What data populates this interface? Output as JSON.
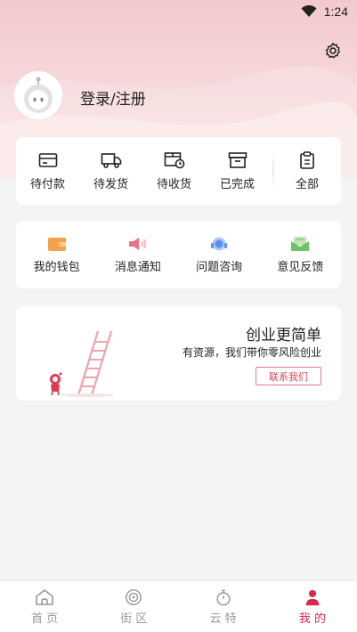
{
  "status_bar": {
    "time": "1:24",
    "icons": [
      "wifi-icon",
      "battery-icon"
    ]
  },
  "profile": {
    "login_label": "登录/注册",
    "settings_icon": "gear-icon"
  },
  "orders": [
    {
      "label": "待付款",
      "icon": "card-icon"
    },
    {
      "label": "待发货",
      "icon": "truck-icon"
    },
    {
      "label": "待收货",
      "icon": "package-clock-icon"
    },
    {
      "label": "已完成",
      "icon": "box-icon"
    },
    {
      "label": "全部",
      "icon": "clipboard-icon"
    }
  ],
  "tools": [
    {
      "label": "我的钱包",
      "icon": "wallet-icon",
      "color": "#f5a04a"
    },
    {
      "label": "消息通知",
      "icon": "speaker-icon",
      "color": "#f0708a"
    },
    {
      "label": "问题咨询",
      "icon": "headset-icon",
      "color": "#5b8ef2"
    },
    {
      "label": "意见反馈",
      "icon": "mail-icon",
      "color": "#6cc36a"
    }
  ],
  "promo": {
    "title": "创业更简单",
    "subtitle": "有资源，我们带你零风险创业",
    "button_label": "联系我们"
  },
  "tabbar": [
    {
      "label": "首 页",
      "icon": "home-icon",
      "active": false
    },
    {
      "label": "街 区",
      "icon": "target-icon",
      "active": false
    },
    {
      "label": "云 特",
      "icon": "timer-icon",
      "active": false
    },
    {
      "label": "我 的",
      "icon": "user-icon",
      "active": true
    }
  ],
  "colors": {
    "accent": "#d9284a",
    "header": "#f3c9cd"
  }
}
